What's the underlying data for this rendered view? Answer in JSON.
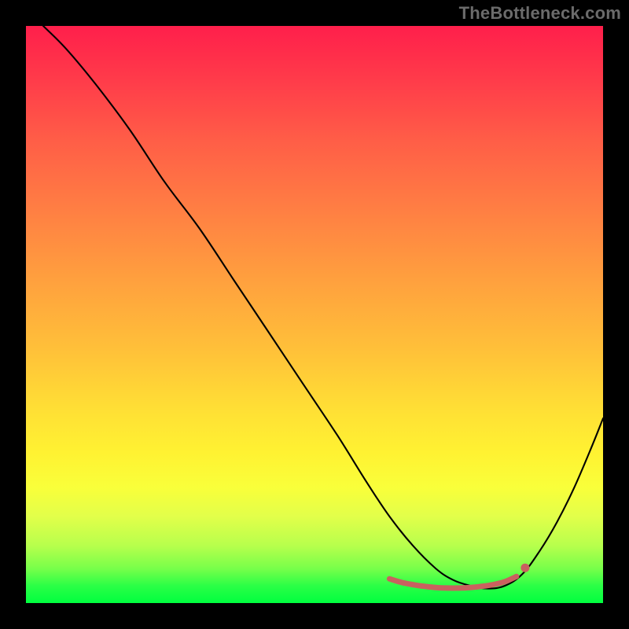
{
  "watermark": "TheBottleneck.com",
  "chart_data": {
    "type": "line",
    "title": "",
    "xlabel": "",
    "ylabel": "",
    "xlim": [
      0,
      100
    ],
    "ylim": [
      0,
      100
    ],
    "grid": false,
    "legend": false,
    "series": [
      {
        "name": "curve",
        "color": "#000000",
        "x": [
          3,
          7,
          12,
          18,
          24,
          30,
          36,
          42,
          48,
          54,
          59,
          63,
          67,
          71,
          74,
          77,
          80,
          83,
          86,
          89,
          92,
          95,
          98,
          100
        ],
        "y": [
          100,
          96,
          90,
          82,
          73,
          65,
          56,
          47,
          38,
          29,
          21,
          15,
          10,
          6,
          4,
          3,
          2.5,
          3,
          5,
          9,
          14,
          20,
          27,
          32
        ]
      }
    ],
    "highlight": {
      "name": "optimal-range",
      "color": "#c9615f",
      "x": [
        63,
        65,
        67,
        69,
        71,
        73,
        75,
        77,
        79,
        81,
        83,
        85
      ],
      "y": [
        4.2,
        3.6,
        3.2,
        2.9,
        2.7,
        2.6,
        2.6,
        2.7,
        2.9,
        3.2,
        3.7,
        4.6
      ]
    }
  }
}
